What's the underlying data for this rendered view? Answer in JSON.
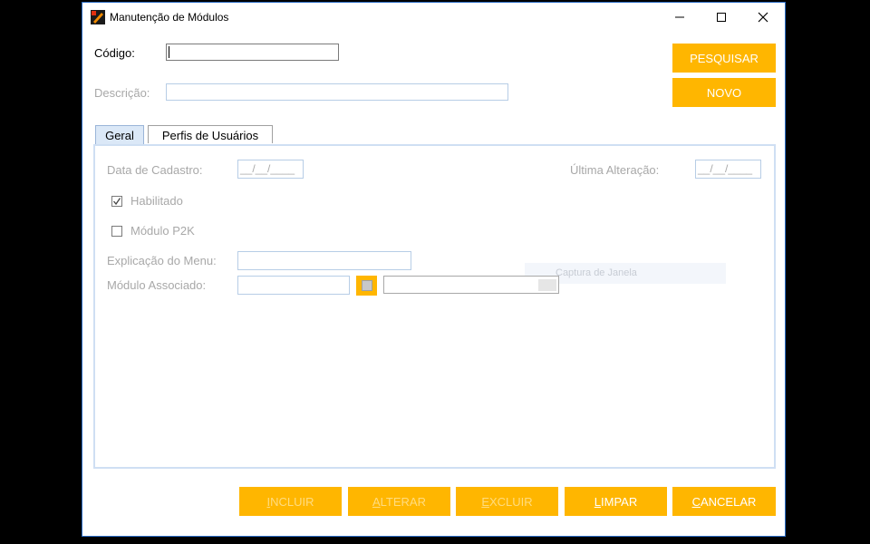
{
  "window": {
    "title": "Manutenção de Módulos"
  },
  "title_controls": {
    "minimize": "—",
    "maximize": "☐",
    "close": "✕"
  },
  "form": {
    "codigo_label": "Código:",
    "codigo_value": "",
    "descricao_label": "Descrição:",
    "descricao_value": ""
  },
  "actions": {
    "pesquisar": "PESQUISAR",
    "novo": "NOVO"
  },
  "tabs": [
    {
      "label": "Geral",
      "selected": true
    },
    {
      "label": "Perfis de Usuários",
      "selected": false
    }
  ],
  "geral": {
    "data_cadastro_label": "Data de Cadastro:",
    "data_cadastro_value": "__/__/____",
    "ultima_alteracao_label": "Última Alteração:",
    "ultima_alteracao_value": "__/__/____",
    "habilitado_label": "Habilitado",
    "habilitado_checked": true,
    "modulo_p2k_label": "Módulo P2K",
    "modulo_p2k_checked": false,
    "explicacao_label": "Explicação do Menu:",
    "explicacao_value": "",
    "modulo_associado_label": "Módulo Associado:",
    "modulo_associado_code": "",
    "modulo_associado_desc": "",
    "ghost_tooltip": "Captura de Janela"
  },
  "footer_buttons": [
    {
      "label": "INCLUIR",
      "mnemonic": "I",
      "rest": "NCLUIR",
      "enabled": false
    },
    {
      "label": "ALTERAR",
      "mnemonic": "A",
      "rest": "LTERAR",
      "enabled": false
    },
    {
      "label": "EXCLUIR",
      "mnemonic": "E",
      "rest": "XCLUIR",
      "enabled": false
    },
    {
      "label": "LIMPAR",
      "mnemonic": "L",
      "rest": "IMPAR",
      "enabled": true
    },
    {
      "label": "CANCELAR",
      "mnemonic": "C",
      "rest": "ANCELAR",
      "enabled": true
    }
  ],
  "colors": {
    "accent": "#ffb600",
    "border": "#2b6cc4",
    "disabled_text": "#a8a8a8"
  }
}
